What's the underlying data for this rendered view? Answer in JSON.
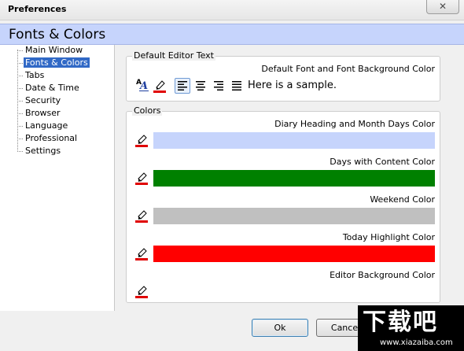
{
  "window": {
    "title": "Preferences",
    "close_glyph": "✕"
  },
  "page": {
    "title": "Fonts & Colors"
  },
  "sidebar": {
    "items": [
      {
        "label": "Main Window",
        "selected": false
      },
      {
        "label": "Fonts & Colors",
        "selected": true
      },
      {
        "label": "Tabs",
        "selected": false
      },
      {
        "label": "Date & Time",
        "selected": false
      },
      {
        "label": "Security",
        "selected": false
      },
      {
        "label": "Browser",
        "selected": false
      },
      {
        "label": "Language",
        "selected": false
      },
      {
        "label": "Professional",
        "selected": false
      },
      {
        "label": "Settings",
        "selected": false
      }
    ]
  },
  "default_editor": {
    "group_label": "Default Editor Text",
    "font_label": "Default Font and Font Background Color",
    "font_icon_text": "A",
    "sample_text": "Here is a sample.",
    "tools": [
      "font-icon",
      "highlight-pen-icon",
      "align-left-icon",
      "align-center-icon",
      "align-right-icon",
      "justify-icon"
    ]
  },
  "colors": {
    "group_label": "Colors",
    "items": [
      {
        "label": "Diary Heading and Month Days Color",
        "color": "#c6d4fc"
      },
      {
        "label": "Days with Content Color",
        "color": "#008000"
      },
      {
        "label": "Weekend Color",
        "color": "#c0c0c0"
      },
      {
        "label": "Today Highlight Color",
        "color": "#ff0000"
      },
      {
        "label": "Editor Background Color",
        "color": "#ffffff"
      }
    ]
  },
  "buttons": {
    "ok": "Ok",
    "cancel": "Cance"
  },
  "watermark": {
    "logo_text": "下载吧",
    "url": "www.xiazaiba.com"
  }
}
